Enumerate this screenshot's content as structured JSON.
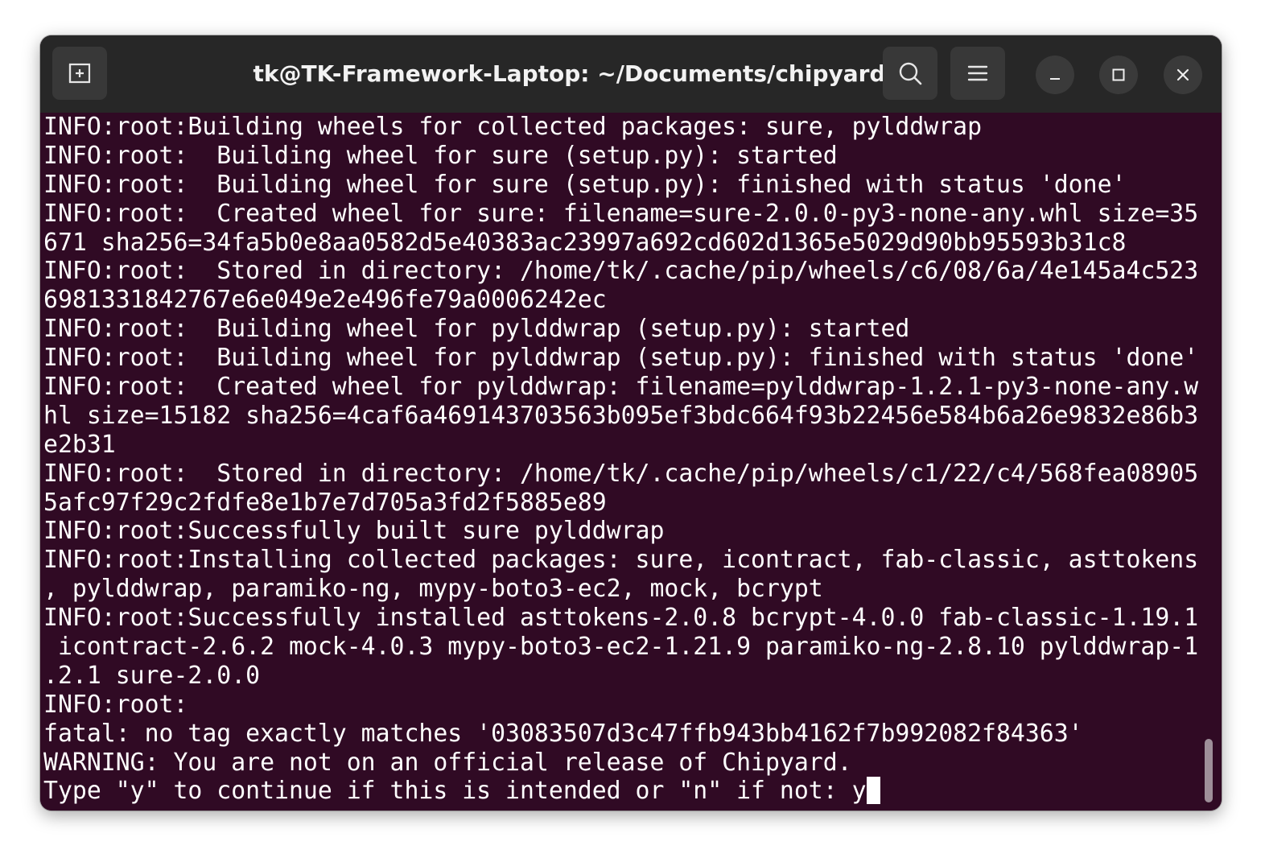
{
  "window": {
    "title": "tk@TK-Framework-Laptop: ~/Documents/chipyard",
    "colors": {
      "titlebar_bg": "#272727",
      "terminal_bg": "#300a24",
      "terminal_fg": "#ffffff"
    }
  },
  "titlebar": {
    "new_tab_icon": "new-tab-icon",
    "search_icon": "search-icon",
    "menu_icon": "hamburger-menu-icon",
    "minimize_icon": "minimize-icon",
    "maximize_icon": "maximize-icon",
    "close_icon": "close-icon"
  },
  "terminal": {
    "lines": [
      "INFO:root:Building wheels for collected packages: sure, pylddwrap",
      "INFO:root:  Building wheel for sure (setup.py): started",
      "INFO:root:  Building wheel for sure (setup.py): finished with status 'done'",
      "INFO:root:  Created wheel for sure: filename=sure-2.0.0-py3-none-any.whl size=35",
      "671 sha256=34fa5b0e8aa0582d5e40383ac23997a692cd602d1365e5029d90bb95593b31c8",
      "INFO:root:  Stored in directory: /home/tk/.cache/pip/wheels/c6/08/6a/4e145a4c523",
      "6981331842767e6e049e2e496fe79a0006242ec",
      "INFO:root:  Building wheel for pylddwrap (setup.py): started",
      "INFO:root:  Building wheel for pylddwrap (setup.py): finished with status 'done'",
      "INFO:root:  Created wheel for pylddwrap: filename=pylddwrap-1.2.1-py3-none-any.w",
      "hl size=15182 sha256=4caf6a469143703563b095ef3bdc664f93b22456e584b6a26e9832e86b3",
      "e2b31",
      "INFO:root:  Stored in directory: /home/tk/.cache/pip/wheels/c1/22/c4/568fea08905",
      "5afc97f29c2fdfe8e1b7e7d705a3fd2f5885e89",
      "INFO:root:Successfully built sure pylddwrap",
      "INFO:root:Installing collected packages: sure, icontract, fab-classic, asttokens",
      ", pylddwrap, paramiko-ng, mypy-boto3-ec2, mock, bcrypt",
      "INFO:root:Successfully installed asttokens-2.0.8 bcrypt-4.0.0 fab-classic-1.19.1",
      " icontract-2.6.2 mock-4.0.3 mypy-boto3-ec2-1.21.9 paramiko-ng-2.8.10 pylddwrap-1",
      ".2.1 sure-2.0.0",
      "INFO:root:",
      "fatal: no tag exactly matches '03083507d3c47ffb943bb4162f7b992082f84363'",
      "WARNING: You are not on an official release of Chipyard.",
      "Type \"y\" to continue if this is intended or \"n\" if not: y"
    ]
  }
}
